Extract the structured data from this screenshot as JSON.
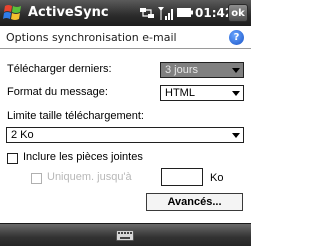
{
  "titlebar": {
    "app_title": "ActiveSync",
    "clock": "01:42",
    "ok_label": "ok"
  },
  "section": {
    "title": "Options synchronisation e-mail",
    "help_label": "?"
  },
  "form": {
    "download_label": "Télécharger derniers:",
    "download_value": "3 jours",
    "format_label": "Format du message:",
    "format_value": "HTML",
    "limit_label": "Limite taille téléchargement:",
    "limit_value": "2 Ko",
    "attachments_label": "Inclure les pièces jointes",
    "only_label": "Uniquem. jusqu'à",
    "ko_label": "Ko",
    "advanced_label": "Avancés..."
  },
  "colors": {
    "titlebar": "#2b2b2b",
    "selected_combo": "#808080",
    "help": "#1b55c8"
  }
}
